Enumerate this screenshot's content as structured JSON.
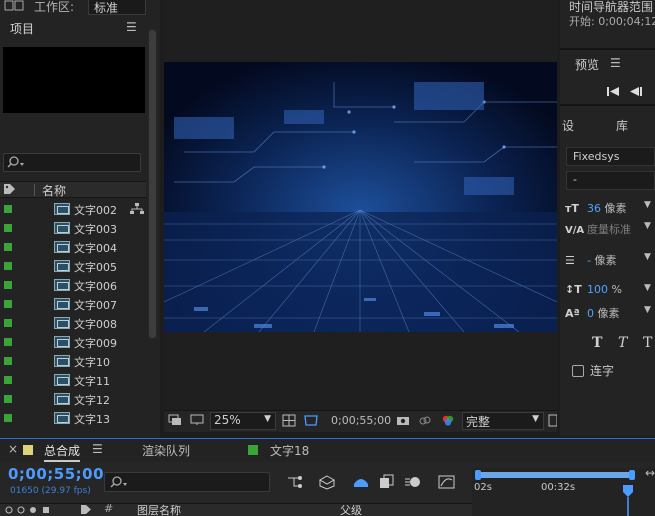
{
  "top_bar": {
    "workspace_label": "工作区:",
    "workspace_value": "标准"
  },
  "project": {
    "title": "项目",
    "column_name": "名称",
    "items": [
      {
        "label": "文字002"
      },
      {
        "label": "文字003"
      },
      {
        "label": "文字004"
      },
      {
        "label": "文字005"
      },
      {
        "label": "文字006"
      },
      {
        "label": "文字007"
      },
      {
        "label": "文字008"
      },
      {
        "label": "文字009"
      },
      {
        "label": "文字10"
      },
      {
        "label": "文字11"
      },
      {
        "label": "文字12"
      },
      {
        "label": "文字13"
      }
    ],
    "label_color": "#3aa43a"
  },
  "viewer": {
    "zoom": "25%",
    "timecode": "0;00;55;00",
    "resolution": "完整"
  },
  "navigator": {
    "title": "时间导航器范围",
    "start": "开始: 0;00;04;12"
  },
  "preview": {
    "title": "预览"
  },
  "character": {
    "tab_settings": "设",
    "tab_library": "库",
    "font_family": "Fixedsys",
    "font_style": "-",
    "size_value": "36",
    "size_unit": "像素",
    "kerning": "度量标准",
    "leading_value": "-",
    "leading_unit": "像素",
    "vscale_value": "100",
    "vscale_unit": "%",
    "baseline_value": "0",
    "baseline_unit": "像素",
    "ligature": "连字"
  },
  "timeline": {
    "tab_comp": "总合成",
    "tab_render": "渲染队列",
    "tab_text": "文字18",
    "time": "0;00;55;00",
    "frames": "01650 (29.97 fps)",
    "col_hash": "#",
    "col_layer_name": "图层名称",
    "col_parent": "父级",
    "tick_start": "02s",
    "tick_mid": "00:32s",
    "accent": "#4c9cff"
  }
}
